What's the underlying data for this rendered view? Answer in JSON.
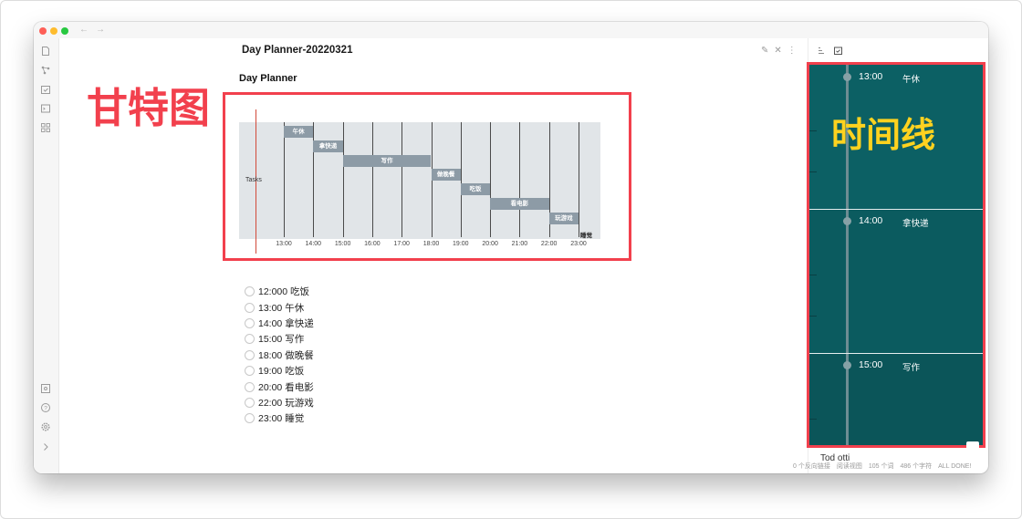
{
  "window": {
    "title": "Day Planner-20220321"
  },
  "editor": {
    "heading": "Day Planner"
  },
  "annotations": {
    "gantt_label": "甘特图",
    "timeline_label": "时间线"
  },
  "gantt": {
    "tasks_label": "Tasks",
    "ticks": [
      "13:00",
      "14:00",
      "15:00",
      "16:00",
      "17:00",
      "18:00",
      "19:00",
      "20:00",
      "21:00",
      "22:00",
      "23:00"
    ],
    "bars": [
      {
        "label": "午休",
        "start": "13:00",
        "end": "14:00"
      },
      {
        "label": "拿快递",
        "start": "14:00",
        "end": "15:00"
      },
      {
        "label": "写作",
        "start": "15:00",
        "end": "18:00"
      },
      {
        "label": "做晚餐",
        "start": "18:00",
        "end": "19:00"
      },
      {
        "label": "吃饭",
        "start": "19:00",
        "end": "20:00"
      },
      {
        "label": "看电影",
        "start": "20:00",
        "end": "22:00"
      },
      {
        "label": "玩游戏",
        "start": "22:00",
        "end": "23:00"
      },
      {
        "label": "睡觉",
        "start": "23:00",
        "end": "23:00"
      }
    ]
  },
  "tasks": [
    {
      "text": "12:000 吃饭"
    },
    {
      "text": "13:00 午休"
    },
    {
      "text": "14:00 拿快递"
    },
    {
      "text": "15:00 写作"
    },
    {
      "text": "18:00 做晚餐"
    },
    {
      "text": "19:00 吃饭"
    },
    {
      "text": "20:00 看电影"
    },
    {
      "text": "22:00 玩游戏"
    },
    {
      "text": "23:00 睡觉"
    }
  ],
  "timeline": [
    {
      "time": "13:00",
      "name": "午休"
    },
    {
      "time": "14:00",
      "name": "拿快递"
    },
    {
      "time": "15:00",
      "name": "写作"
    }
  ],
  "status_bar": {
    "backlinks": "0 个反向链接",
    "mode": "阅读视图",
    "words": "105 个词",
    "chars": "486 个字符",
    "all_done": "ALL DONE!"
  },
  "sidepanel": {
    "peek_text": "Tod          otti"
  },
  "colors": {
    "annotation_red": "#f2404d",
    "annotation_yellow": "#ffd21f",
    "timeline_bg": "#0c5f63",
    "gantt_bar": "#8d9ba6"
  },
  "icons": {
    "ribbon_top": [
      "file-icon",
      "graph-icon",
      "calendar-check-icon",
      "terminal-icon",
      "grid-icon"
    ],
    "ribbon_bottom": [
      "vault-icon",
      "help-icon",
      "settings-icon",
      "expand-icon"
    ]
  }
}
